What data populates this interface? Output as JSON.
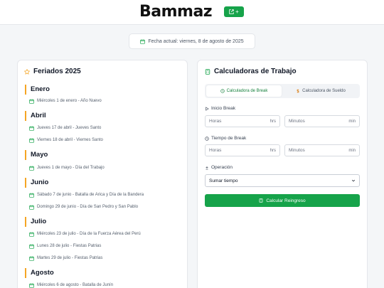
{
  "header": {
    "logo": "Bammaz",
    "button_label": "+"
  },
  "date_banner": {
    "text": "Fecha actual: viernes, 8 de agosto de 2025"
  },
  "holidays": {
    "title": "Feriados 2025",
    "months": [
      {
        "name": "Enero",
        "items": [
          "Miércoles 1 de enero - Año Nuevo"
        ]
      },
      {
        "name": "Abril",
        "items": [
          "Jueves 17 de abril - Jueves Santo",
          "Viernes 18 de abril - Viernes Santo"
        ]
      },
      {
        "name": "Mayo",
        "items": [
          "Jueves 1 de mayo - Día del Trabajo"
        ]
      },
      {
        "name": "Junio",
        "items": [
          "Sábado 7 de junio - Batalla de Arica y Día de la Bandera",
          "Domingo 29 de junio - Día de San Pedro y San Pablo"
        ]
      },
      {
        "name": "Julio",
        "items": [
          "Miércoles 23 de julio - Día de la Fuerza Aérea del Perú",
          "Lunes 28 de julio - Fiestas Patrias",
          "Martes 29 de julio - Fiestas Patrias"
        ]
      },
      {
        "name": "Agosto",
        "items": [
          "Miércoles 6 de agosto - Batalla de Junín"
        ]
      }
    ]
  },
  "calculators": {
    "title": "Calculadoras de Trabajo",
    "tabs": [
      {
        "label": "Calculadora de Break",
        "active": true
      },
      {
        "label": "Calculadora de Sueldo",
        "active": false
      }
    ],
    "break_start": {
      "label": "Inicio Break",
      "hours_placeholder": "Horas",
      "hours_unit": "hrs",
      "minutes_placeholder": "Minutos",
      "minutes_unit": "min"
    },
    "break_time": {
      "label": "Tiempo de Break",
      "hours_placeholder": "Horas",
      "hours_unit": "hrs",
      "minutes_placeholder": "Minutos",
      "minutes_unit": "min"
    },
    "operation": {
      "label": "Operación",
      "selected": "Sumar tiempo"
    },
    "submit_label": "Calcular Reingreso"
  },
  "colors": {
    "accent_green": "#16a34a",
    "month_bar": "#f5a524",
    "star": "#f5a524"
  }
}
